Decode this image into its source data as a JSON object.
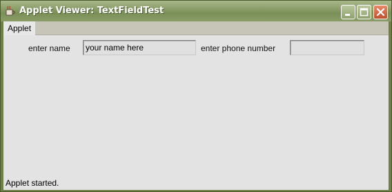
{
  "window": {
    "title": "Applet Viewer: TextFieldTest",
    "controls": {
      "minimize": "minimize-icon",
      "maximize": "maximize-icon",
      "close": "close-icon"
    },
    "colors": {
      "frame": "#6e7f4a",
      "close": "#c1502e",
      "client": "#e3e3e3"
    }
  },
  "menubar": {
    "items": [
      {
        "label": "Applet"
      }
    ]
  },
  "form": {
    "name_label": "enter name",
    "name_value": "your name here",
    "phone_label": "enter phone number",
    "phone_value": ""
  },
  "status": {
    "text": "Applet started."
  }
}
